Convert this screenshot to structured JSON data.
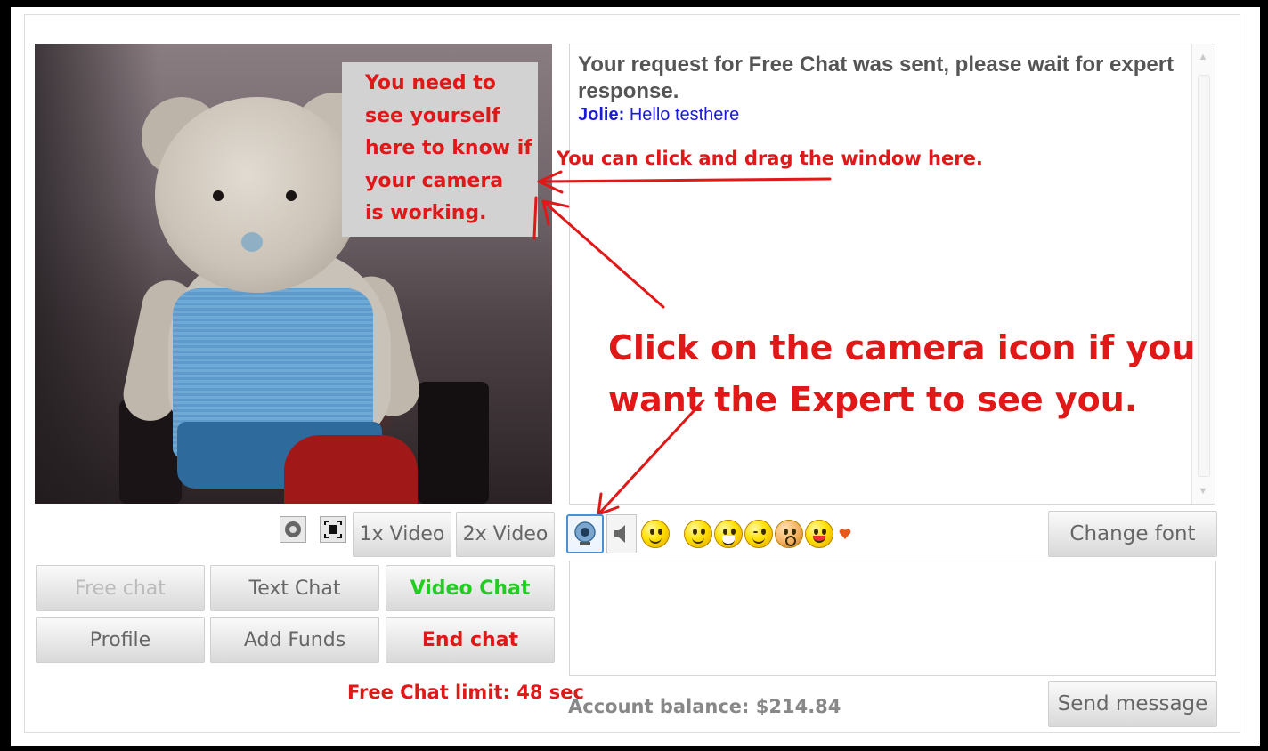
{
  "video": {
    "webcam_hint": [
      "You need to",
      "see yourself",
      "here to know if",
      "your camera",
      "is working."
    ],
    "settings_icon": "webcam-settings-icon",
    "fullscreen_icon": "fullscreen-icon",
    "video_1x_label": "1x Video",
    "video_2x_label": "2x Video"
  },
  "buttons": {
    "free_chat": "Free chat",
    "text_chat": "Text Chat",
    "video_chat": "Video Chat",
    "profile": "Profile",
    "add_funds": "Add Funds",
    "end_chat": "End chat"
  },
  "colors": {
    "annotation_red": "#e01818",
    "video_chat_green": "#22cc22",
    "chat_blue": "#1a1ad8",
    "disabled_gray": "#bbbbbb"
  },
  "free_chat_limit": "Free Chat limit: 48 sec",
  "chat": {
    "status_message": "Your request for Free Chat was sent, please wait for expert response.",
    "messages": [
      {
        "sender": "Jolie:",
        "text": "Hello testhere"
      }
    ]
  },
  "annotations": {
    "drag_hint": "You can click and drag the window here.",
    "camera_hint_line1": "Click on the camera icon if you",
    "camera_hint_line2": "want the Expert to see you."
  },
  "toolbar": {
    "icons": [
      "camera-icon",
      "sound-icon",
      "smiley-menu-icon",
      "smile-icon",
      "grin-icon",
      "wink-icon",
      "surprised-icon",
      "tongue-icon",
      "heart-icon"
    ],
    "change_font_label": "Change font",
    "send_message_label": "Send message"
  },
  "account_balance": "Account balance: $214.84"
}
